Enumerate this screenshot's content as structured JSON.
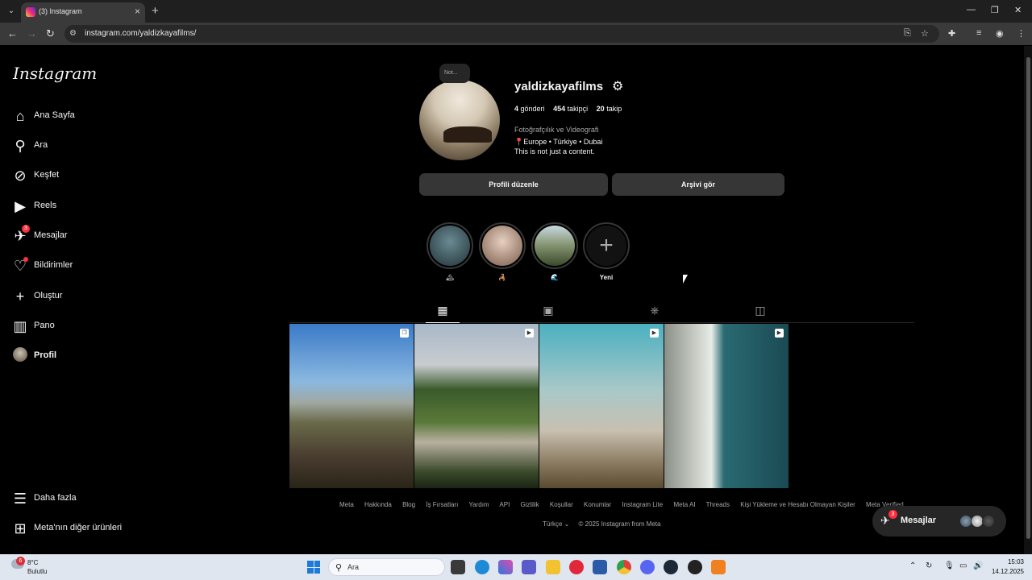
{
  "browser": {
    "tab_title": "(3) Instagram",
    "url": "instagram.com/yaldizkayafilms/"
  },
  "sidebar": {
    "logo": "Instagram",
    "items": [
      {
        "label": "Ana Sayfa",
        "icon": "home-icon"
      },
      {
        "label": "Ara",
        "icon": "search-icon"
      },
      {
        "label": "Keşfet",
        "icon": "compass-icon"
      },
      {
        "label": "Reels",
        "icon": "reels-icon"
      },
      {
        "label": "Mesajlar",
        "icon": "messenger-icon",
        "badge": "3"
      },
      {
        "label": "Bildirimler",
        "icon": "heart-icon"
      },
      {
        "label": "Oluştur",
        "icon": "plus-icon"
      },
      {
        "label": "Pano",
        "icon": "dashboard-icon"
      },
      {
        "label": "Profil",
        "icon": "avatar"
      }
    ],
    "bottom": [
      {
        "label": "Daha fazla",
        "icon": "menu-icon"
      },
      {
        "label": "Meta'nın diğer ürünleri",
        "icon": "apps-icon"
      }
    ]
  },
  "profile": {
    "note": "Not...",
    "username": "yaldizkayafilms",
    "posts_count": "4",
    "posts_label": "gönderi",
    "followers_count": "454",
    "followers_label": "takipçi",
    "following_count": "20",
    "following_label": "takip",
    "category": "Fotoğrafçılık ve Videografi",
    "bio_location": "📍Europe • Türkiye • Dubai",
    "bio_text": "This is not just a content.",
    "edit_button": "Profili düzenle",
    "archive_button": "Arşivi gör"
  },
  "highlights": [
    {
      "label": "🏔"
    },
    {
      "label": "🦂"
    },
    {
      "label": "🌊"
    },
    {
      "label": "Yeni"
    }
  ],
  "tabs": [
    {
      "icon": "grid-icon",
      "active": true
    },
    {
      "icon": "reels-tab-icon",
      "active": false
    },
    {
      "icon": "saved-icon",
      "active": false
    },
    {
      "icon": "tagged-icon",
      "active": false
    }
  ],
  "posts": [
    {
      "type": "carousel",
      "subject": "canyon-sky"
    },
    {
      "type": "reel",
      "subject": "castle-forest"
    },
    {
      "type": "reel",
      "subject": "balloons"
    },
    {
      "type": "reel",
      "subject": "coast-aerial"
    }
  ],
  "footer": {
    "links": [
      "Meta",
      "Hakkında",
      "Blog",
      "İş Fırsatları",
      "Yardım",
      "API",
      "Gizlilik",
      "Koşullar",
      "Konumlar",
      "Instagram Lite",
      "Meta AI",
      "Threads",
      "Kişi Yükleme ve Hesabı Olmayan Kişiler",
      "Meta Verified"
    ],
    "language": "Türkçe",
    "copyright": "© 2025 Instagram from Meta"
  },
  "messages_pill": {
    "label": "Mesajlar",
    "badge": "3"
  },
  "taskbar": {
    "weather_badge": "6",
    "temp": "8°C",
    "condition": "Bulutlu",
    "search_placeholder": "Ara",
    "time": "15:03",
    "date": "14.12.2025"
  },
  "colors": {
    "background": "#000000",
    "button": "#363636",
    "badge": "#ff3040",
    "secondary_text": "#a8a8a8"
  }
}
